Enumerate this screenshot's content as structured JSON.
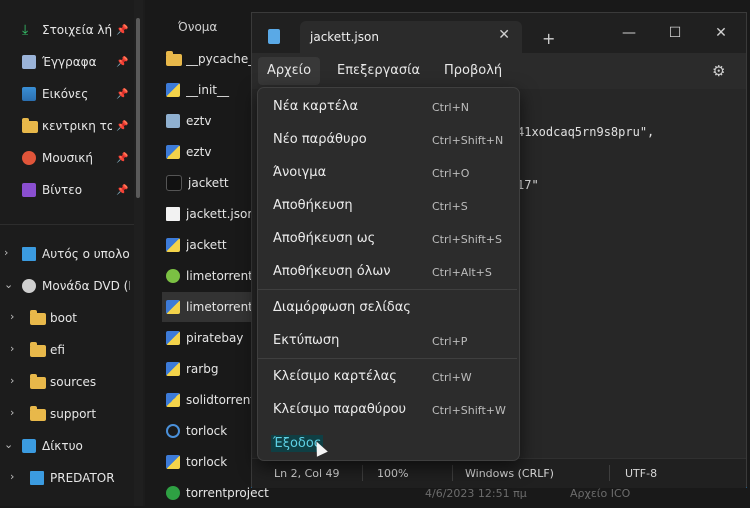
{
  "sidebar": {
    "quick_access": [
      {
        "label": "Στοιχεία λήψ",
        "icon": "download-icon"
      },
      {
        "label": "Έγγραφα",
        "icon": "documents-icon"
      },
      {
        "label": "Εικόνες",
        "icon": "pictures-icon"
      },
      {
        "label": "κεντρικη τοπ",
        "icon": "folder-icon"
      },
      {
        "label": "Μουσική",
        "icon": "music-icon"
      },
      {
        "label": "Βίντεο",
        "icon": "videos-icon"
      }
    ],
    "tree": [
      {
        "label": "Αυτός ο υπολο",
        "icon": "this-pc-icon"
      },
      {
        "label": "Μονάδα DVD (D",
        "icon": "dvd-drive-icon"
      },
      {
        "label": "boot",
        "icon": "folder-icon"
      },
      {
        "label": "efi",
        "icon": "folder-icon"
      },
      {
        "label": "sources",
        "icon": "folder-icon"
      },
      {
        "label": "support",
        "icon": "folder-icon"
      },
      {
        "label": "Δίκτυο",
        "icon": "network-icon"
      },
      {
        "label": "PREDATOR",
        "icon": "computer-icon"
      }
    ]
  },
  "filelist": {
    "column_header": "Όνομα",
    "files": [
      {
        "label": "__pycache__",
        "icon": "folder-icon"
      },
      {
        "label": "__init__",
        "icon": "python-file-icon"
      },
      {
        "label": "eztv",
        "icon": "eztv-icon"
      },
      {
        "label": "eztv",
        "icon": "python-file-icon"
      },
      {
        "label": "jackett",
        "icon": "jackett-icon"
      },
      {
        "label": "jackett.json",
        "icon": "json-file-icon"
      },
      {
        "label": "jackett",
        "icon": "python-file-icon"
      },
      {
        "label": "limetorrents",
        "icon": "limetorrents-icon"
      },
      {
        "label": "limetorrents",
        "icon": "python-file-icon"
      },
      {
        "label": "piratebay",
        "icon": "python-file-icon"
      },
      {
        "label": "rarbg",
        "icon": "python-file-icon"
      },
      {
        "label": "solidtorrents",
        "icon": "python-file-icon"
      },
      {
        "label": "torlock",
        "icon": "torlock-icon"
      },
      {
        "label": "torlock",
        "icon": "python-file-icon"
      },
      {
        "label": "torrentproject",
        "icon": "torrentproject-icon"
      }
    ],
    "last_row_date": "4/6/2023 12:51 πμ",
    "last_row_type": "Αρχείο ICO"
  },
  "notepad": {
    "tab_title": "jackett.json",
    "menus": [
      "Αρχείο",
      "Επεξεργασία",
      "Προβολή"
    ],
    "code_fragment_1": "41xodcaq5rn9s8pru\",",
    "code_fragment_2": "17\"",
    "status": {
      "position": "Ln 2, Col 49",
      "zoom": "100%",
      "line_ending": "Windows (CRLF)",
      "encoding": "UTF-8"
    }
  },
  "file_menu": {
    "groups": [
      [
        {
          "label": "Νέα καρτέλα",
          "shortcut": "Ctrl+N"
        },
        {
          "label": "Νέο παράθυρο",
          "shortcut": "Ctrl+Shift+N"
        },
        {
          "label": "Άνοιγμα",
          "shortcut": "Ctrl+O"
        },
        {
          "label": "Αποθήκευση",
          "shortcut": "Ctrl+S"
        },
        {
          "label": "Αποθήκευση ως",
          "shortcut": "Ctrl+Shift+S"
        },
        {
          "label": "Αποθήκευση όλων",
          "shortcut": "Ctrl+Alt+S"
        }
      ],
      [
        {
          "label": "Διαμόρφωση σελίδας",
          "shortcut": ""
        },
        {
          "label": "Εκτύπωση",
          "shortcut": "Ctrl+P"
        }
      ],
      [
        {
          "label": "Κλείσιμο καρτέλας",
          "shortcut": "Ctrl+W"
        },
        {
          "label": "Κλείσιμο παραθύρου",
          "shortcut": "Ctrl+Shift+W"
        },
        {
          "label": "Έξοδος",
          "shortcut": ""
        }
      ]
    ]
  },
  "colors": {
    "accent": "#0a77c2",
    "hover_highlight": "#5ed0e4",
    "folder": "#e8b84a"
  }
}
